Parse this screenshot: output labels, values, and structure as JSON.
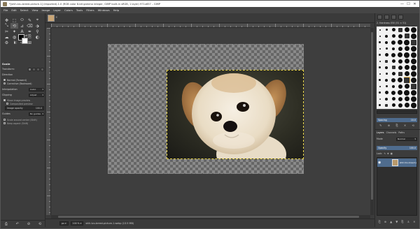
{
  "window": {
    "title": "*[shih-tzu-breed-picture-1] (imported)-1.0 (RGB color 8-bit gamma integer, GIMP built-in sRGB, 1 layer) 971x657 – GIMP",
    "minimize": "—",
    "maximize": "☐",
    "close": "✕"
  },
  "menubar": [
    "File",
    "Edit",
    "Select",
    "View",
    "Image",
    "Layer",
    "Colors",
    "Tools",
    "Filters",
    "Windows",
    "Help"
  ],
  "toolbox": {
    "tools": [
      "✥",
      "⬚",
      "⬭",
      "✎",
      "⌖",
      "⤡",
      "⟲",
      "⊿",
      "⌫",
      "⬗",
      "✂",
      "✦",
      "A",
      "✒",
      "⚲",
      "☁",
      "◍",
      "⊕",
      "⎘",
      "◐",
      "⚙",
      "⌇",
      "✑",
      "⊞"
    ],
    "active_tool_index": 6,
    "tool_options": {
      "title": "Scale",
      "transform_label": "Transform:",
      "direction_label": "Direction",
      "direction_normal": "Normal (Forward)",
      "direction_corrective": "Corrective (Backward)",
      "interpolation_label": "Interpolation",
      "interpolation_value": "Cubic",
      "clipping_label": "Clipping",
      "clipping_value": "Adjust",
      "show_image_preview": "Show image preview",
      "composited_preview": "Composited preview",
      "image_opacity": "Image opacity",
      "image_opacity_value": "100.0",
      "guides_label": "Guides",
      "guides_value": "No guides",
      "scale_around_center": "Scale around center (Shift)",
      "keep_aspect": "Keep aspect (Shift)"
    },
    "footer_icons": [
      "⎙",
      "↶",
      "⊘",
      "⟲"
    ]
  },
  "status": {
    "unit": "px",
    "zoom": "100 %",
    "text": "shih-tzu-breed-picture-1.webp (13.5 MB)"
  },
  "dock": {
    "brush_header": "2. Hardness 050 (51 × 51)",
    "brush_spacing_label": "Spacing",
    "brush_spacing_value": "10.0",
    "layers_tabs": [
      "Layers",
      "Channels",
      "Paths"
    ],
    "mode_label": "Mode",
    "mode_value": "Normal",
    "opacity_label": "Opacity",
    "opacity_value": "100.0",
    "lock_label": "Lock:",
    "layer_name": "shih-tzu-breed-p",
    "footer_icons": [
      "⎗",
      "⊕",
      "▲",
      "▼",
      "⎘",
      "⚓",
      "✕"
    ]
  }
}
